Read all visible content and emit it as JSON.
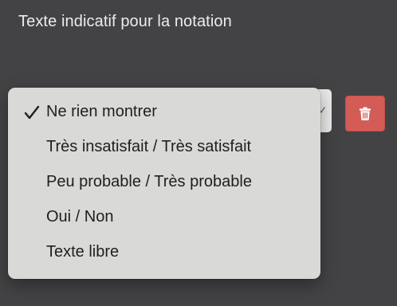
{
  "section": {
    "title": "Texte indicatif pour la notation"
  },
  "select": {
    "selected_value": "Ne rien montrer",
    "options": [
      {
        "label": "Ne rien montrer",
        "selected": true
      },
      {
        "label": "Très insatisfait / Très satisfait",
        "selected": false
      },
      {
        "label": "Peu probable / Très probable",
        "selected": false
      },
      {
        "label": "Oui / Non",
        "selected": false
      },
      {
        "label": "Texte libre",
        "selected": false
      }
    ]
  },
  "icons": {
    "checkmark": "checkmark-icon",
    "chevron": "chevron-down-icon",
    "delete": "trash-icon"
  },
  "colors": {
    "background": "#434345",
    "delete_button": "#d45c57",
    "dropdown_background": "#d9d9d7"
  }
}
